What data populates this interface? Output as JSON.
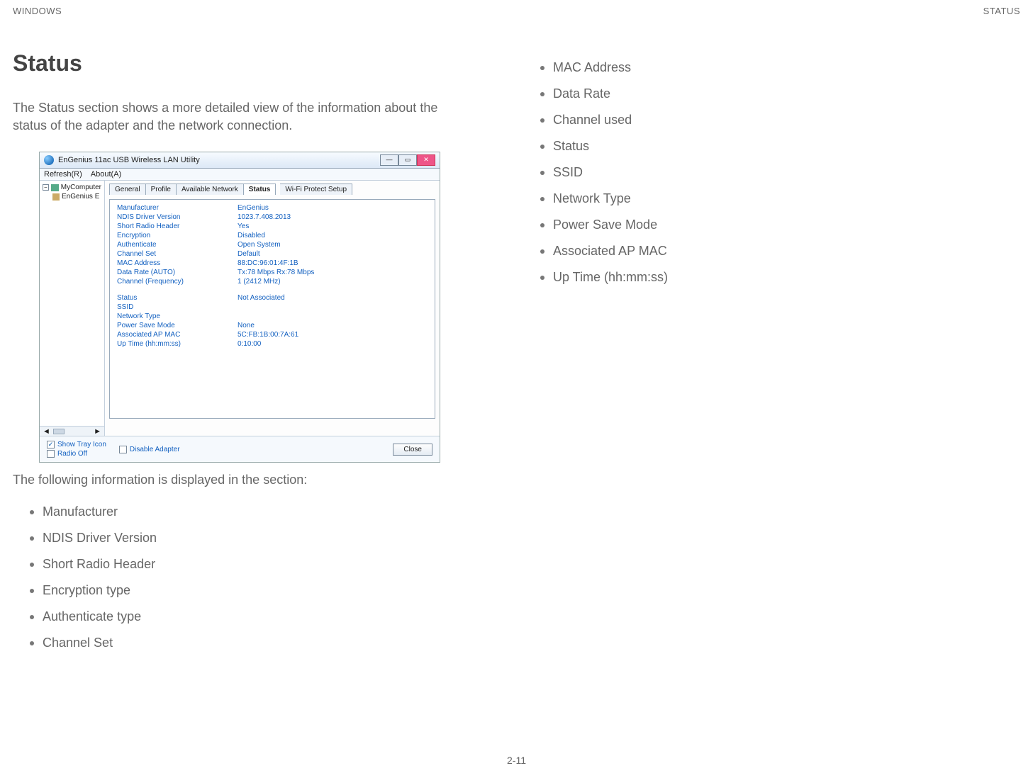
{
  "header": {
    "left": "WINDOWS",
    "right": "STATUS"
  },
  "page": {
    "heading": "Status",
    "lead": "The Status section shows a more detailed view of the information about the status of the adapter and the network connection.",
    "after": "The following information is displayed in the section:",
    "number": "2-11"
  },
  "bullets_left": [
    "Manufacturer",
    "NDIS Driver Version",
    "Short Radio Header",
    "Encryption type",
    "Authenticate type",
    "Channel Set"
  ],
  "bullets_right": [
    "MAC Address",
    "Data Rate",
    "Channel used",
    "Status",
    "SSID",
    "Network Type",
    "Power Save Mode",
    "Associated AP MAC",
    "Up Time (hh:mm:ss)"
  ],
  "screenshot": {
    "title": "EnGenius 11ac USB Wireless LAN Utility",
    "menu": {
      "refresh": "Refresh(R)",
      "about": "About(A)"
    },
    "tree": {
      "root": "MyComputer",
      "child": "EnGenius E"
    },
    "tabs": {
      "general": "General",
      "profile": "Profile",
      "available": "Available Network",
      "status": "Status",
      "wps": "Wi-Fi Protect Setup"
    },
    "rows": [
      {
        "label": "Manufacturer",
        "value": "EnGenius"
      },
      {
        "label": "NDIS Driver Version",
        "value": "1023.7.408.2013"
      },
      {
        "label": "Short Radio Header",
        "value": "Yes"
      },
      {
        "label": "Encryption",
        "value": "Disabled"
      },
      {
        "label": "Authenticate",
        "value": "Open System"
      },
      {
        "label": "Channel Set",
        "value": "Default"
      },
      {
        "label": "MAC Address",
        "value": "88:DC:96:01:4F:1B"
      },
      {
        "label": "Data Rate (AUTO)",
        "value": "Tx:78 Mbps Rx:78 Mbps"
      },
      {
        "label": "Channel (Frequency)",
        "value": "1 (2412 MHz)"
      }
    ],
    "rows2": [
      {
        "label": "Status",
        "value": "Not Associated"
      },
      {
        "label": "SSID",
        "value": ""
      },
      {
        "label": "Network Type",
        "value": ""
      },
      {
        "label": "Power Save Mode",
        "value": "None"
      },
      {
        "label": "Associated AP MAC",
        "value": "5C:FB:1B:00:7A:61"
      },
      {
        "label": "Up Time (hh:mm:ss)",
        "value": "0:10:00"
      }
    ],
    "footer": {
      "show_tray": "Show Tray Icon",
      "radio_off": "Radio Off",
      "disable_adapter": "Disable Adapter",
      "close": "Close"
    }
  }
}
